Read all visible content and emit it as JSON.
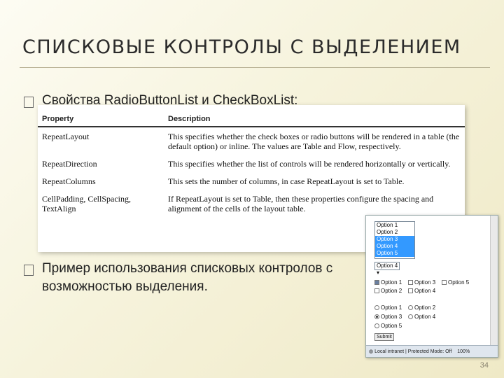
{
  "slide": {
    "title": "СПИСКОВЫЕ КОНТРОЛЫ С ВЫДЕЛЕНИЕМ",
    "bullet1": "Свойства RadioButtonList и CheckBoxList:",
    "bullet2": "Пример использования списковых контролов с возможностью выделения.",
    "page_number": "34",
    "bullet_icon": "square-bullet-icon"
  },
  "table": {
    "headers": [
      "Property",
      "Description"
    ],
    "rows": [
      [
        "RepeatLayout",
        "This specifies whether the check boxes or radio buttons will be rendered in a table (the default option) or inline. The values are Table and Flow, respectively."
      ],
      [
        "RepeatDirection",
        "This specifies whether the list of controls will be rendered horizontally or vertically."
      ],
      [
        "RepeatColumns",
        "This sets the number of columns, in case RepeatLayout is set to Table."
      ],
      [
        "CellPadding, CellSpacing, TextAlign",
        "If RepeatLayout is set to Table, then these properties configure the spacing and alignment of the cells of the layout table."
      ]
    ]
  },
  "browser": {
    "listbox_options": [
      "Option 1",
      "Option 2",
      "Option 3",
      "Option 4",
      "Option 5"
    ],
    "listbox_selected": [
      2,
      3,
      4
    ],
    "dropdown_value": "Option 4",
    "checkboxes": [
      {
        "label": "Option 1",
        "checked": true
      },
      {
        "label": "Option 3",
        "checked": false
      },
      {
        "label": "Option 5",
        "checked": false
      },
      {
        "label": "Option 2",
        "checked": false
      },
      {
        "label": "Option 4",
        "checked": false
      }
    ],
    "radios": [
      {
        "label": "Option 1",
        "checked": false
      },
      {
        "label": "Option 2",
        "checked": false
      },
      {
        "label": "Option 3",
        "checked": true
      },
      {
        "label": "Option 4",
        "checked": false
      },
      {
        "label": "Option 5",
        "checked": false
      }
    ],
    "submit_label": "Submit",
    "status_text": "Local intranet | Protected Mode: Off",
    "zoom": "100%"
  }
}
